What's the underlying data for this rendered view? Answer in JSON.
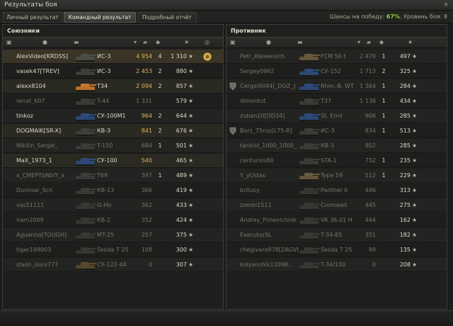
{
  "window": {
    "title": "Результаты боя",
    "close_glyph": "×"
  },
  "tabs": [
    {
      "label": "Личный результат"
    },
    {
      "label": "Командный результат"
    },
    {
      "label": "Подробный отчёт"
    }
  ],
  "win_chance": {
    "prefix": "Шансы на победу: ",
    "value": "67%",
    "suffix": ". Уровень боя: 8"
  },
  "allies": {
    "title": "Союзники",
    "rows": [
      {
        "player": "AlexVideo[KRDSS]",
        "vehicle": "ИС-3",
        "damage": "4 954",
        "kills": "4",
        "xp": "1 310",
        "medal": true,
        "tank_color": "#4a4d47",
        "state": "me"
      },
      {
        "player": "vasek47[TREV]",
        "vehicle": "ИС-3",
        "damage": "2 453",
        "kills": "2",
        "xp": "880",
        "tank_color": "#3d403a"
      },
      {
        "player": "alexx8104",
        "vehicle": "T34",
        "damage": "2 094",
        "kills": "2",
        "xp": "857",
        "tank_color": "#c8772a",
        "state": "hl"
      },
      {
        "player": "renat_607",
        "vehicle": "T-44",
        "damage": "1 331",
        "kills": "",
        "xp": "579",
        "tank_color": "#3a3d38",
        "dead": true
      },
      {
        "player": "tinkoz",
        "vehicle": "СУ-100М1",
        "damage": "964",
        "kills": "2",
        "xp": "644",
        "tank_color": "#2d4a7a"
      },
      {
        "player": "DOGMAIK[SR-X]",
        "vehicle": "КВ-3",
        "damage": "841",
        "kills": "2",
        "xp": "676",
        "tank_color": "#3e413b",
        "state": "hl"
      },
      {
        "player": "Nikitin_Sergei_",
        "vehicle": "T-150",
        "damage": "684",
        "kills": "1",
        "xp": "501",
        "tank_color": "#3a3d38",
        "dead": true
      },
      {
        "player": "MaX_1973_1",
        "vehicle": "СУ-100",
        "damage": "540",
        "kills": "",
        "xp": "465",
        "tank_color": "#2d4a7a",
        "state": "hl"
      },
      {
        "player": "x_CMEPTbNbIY_x",
        "vehicle": "T69",
        "damage": "397",
        "kills": "1",
        "xp": "489",
        "tank_color": "#3a3d38",
        "dead": true
      },
      {
        "player": "Durimar_Sch",
        "vehicle": "КВ-13",
        "damage": "366",
        "kills": "",
        "xp": "419",
        "tank_color": "#383b36",
        "dead": true
      },
      {
        "player": "vas51111",
        "vehicle": "O-Ho",
        "damage": "362",
        "kills": "",
        "xp": "433",
        "tank_color": "#363934",
        "dead": true
      },
      {
        "player": "iram2009",
        "vehicle": "КВ-2",
        "damage": "352",
        "kills": "",
        "xp": "424",
        "tank_color": "#363934",
        "dead": true
      },
      {
        "player": "Aguenno[TOUGH]",
        "vehicle": "MT-25",
        "damage": "257",
        "kills": "",
        "xp": "375",
        "tank_color": "#363934",
        "dead": true
      },
      {
        "player": "tiger199003",
        "vehicle": "Škoda T 25",
        "damage": "108",
        "kills": "",
        "xp": "300",
        "tank_color": "#363934",
        "dead": true
      },
      {
        "player": "stalin_iosiv777",
        "vehicle": "СУ-122-44",
        "damage": "0",
        "kills": "",
        "xp": "307",
        "tank_color": "#5a4a2a",
        "dead": true
      }
    ]
  },
  "enemies": {
    "title": "Противник",
    "rows": [
      {
        "player": "Petr_Alexeevich",
        "vehicle": "FCM 50 t",
        "damage": "2 479",
        "kills": "1",
        "xp": "497",
        "tank_color": "#6a5a3e",
        "dead": true
      },
      {
        "player": "Sergey0962",
        "vehicle": "СУ-152",
        "damage": "1 713",
        "kills": "2",
        "xp": "325",
        "tank_color": "#2d4a7a",
        "dead": true
      },
      {
        "player": "Cergei9044[_DOZ_]",
        "vehicle": "Rhm.-B. WT",
        "damage": "1 364",
        "kills": "1",
        "xp": "284",
        "tank_color": "#2d4a7a",
        "dead": true,
        "clan": true
      },
      {
        "player": "dimontut",
        "vehicle": "T37",
        "damage": "1 138",
        "kills": "1",
        "xp": "434",
        "tank_color": "#3a3d38",
        "dead": true
      },
      {
        "player": "zuban20[DD34]",
        "vehicle": "St. Emil",
        "damage": "906",
        "kills": "1",
        "xp": "285",
        "tank_color": "#2d4a7a",
        "dead": true
      },
      {
        "player": "Borz_75rus[L75-R]",
        "vehicle": "ИС-3",
        "damage": "834",
        "kills": "1",
        "xp": "513",
        "tank_color": "#3a3d38",
        "dead": true,
        "clan": true
      },
      {
        "player": "tankist_1000_1000_",
        "vehicle": "КВ-3",
        "damage": "802",
        "kills": "",
        "xp": "285",
        "tank_color": "#3a3d38",
        "dead": true
      },
      {
        "player": "centurios80",
        "vehicle": "STA-1",
        "damage": "732",
        "kills": "1",
        "xp": "235",
        "tank_color": "#3a3d38",
        "dead": true
      },
      {
        "player": "Y_yUstas",
        "vehicle": "Type 59",
        "damage": "512",
        "kills": "1",
        "xp": "229",
        "tank_color": "#6a5a3e",
        "dead": true
      },
      {
        "player": "britusy",
        "vehicle": "Panther II",
        "damage": "446",
        "kills": "",
        "xp": "313",
        "tank_color": "#363934",
        "dead": true
      },
      {
        "player": "zombi1511",
        "vehicle": "Cromwell",
        "damage": "445",
        "kills": "",
        "xp": "275",
        "tank_color": "#363934",
        "dead": true
      },
      {
        "player": "Andrey_Pshenichnik",
        "vehicle": "VK 36.01 H",
        "damage": "444",
        "kills": "",
        "xp": "162",
        "tank_color": "#363934",
        "dead": true
      },
      {
        "player": "ExecutorSL",
        "vehicle": "T-34-85",
        "damage": "351",
        "kills": "",
        "xp": "182",
        "tank_color": "#363934",
        "dead": true
      },
      {
        "player": "chegivara978[ZAGVR]",
        "vehicle": "Škoda T 25",
        "damage": "99",
        "kills": "",
        "xp": "135",
        "tank_color": "#363934",
        "dead": true
      },
      {
        "player": "kolyanchik12098...",
        "vehicle": "T-34/100",
        "damage": "0",
        "kills": "",
        "xp": "208",
        "tank_color": "#363934",
        "dead": true
      }
    ]
  },
  "column_icons": [
    "platoon-icon",
    "tank-icon",
    "player-icon",
    "damage-icon",
    "kills-icon",
    "xp-star-icon"
  ]
}
